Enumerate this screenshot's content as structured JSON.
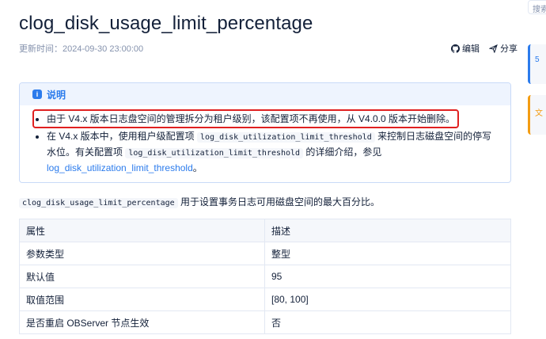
{
  "page": {
    "title": "clog_disk_usage_limit_percentage",
    "updated": "更新时间：2024-09-30 23:00:00",
    "edit_label": "编辑",
    "share_label": "分享"
  },
  "sidebar": {
    "search_text": "搜索",
    "card1_text": "5",
    "card2_text": "文"
  },
  "note": {
    "header": "说明",
    "info_icon_char": "i",
    "item1": "由于 V4.x 版本日志盘空间的管理拆分为租户级别，该配置项不再使用，从 V4.0.0 版本开始删除。",
    "item2_a": "在 V4.x 版本中，使用租户级配置项 ",
    "item2_code1": "log_disk_utilization_limit_threshold",
    "item2_b": " 来控制日志磁盘空间的停写水位。有关配置项 ",
    "item2_code2": "log_disk_utilization_limit_threshold",
    "item2_c": " 的详细介绍，参见 ",
    "item2_link": "log_disk_utilization_limit_threshold",
    "item2_d": "。"
  },
  "description": {
    "code": "clog_disk_usage_limit_percentage",
    "text": " 用于设置事务日志可用磁盘空间的最大百分比。"
  },
  "table": {
    "headers": [
      "属性",
      "描述"
    ],
    "rows": [
      [
        "参数类型",
        "整型"
      ],
      [
        "默认值",
        "95"
      ],
      [
        "取值范围",
        "[80, 100]"
      ],
      [
        "是否重启 OBServer 节点生效",
        "否"
      ]
    ]
  },
  "colors": {
    "accent": "#2b7bec",
    "highlight_frame": "#e02020",
    "warning": "#f39c12"
  }
}
